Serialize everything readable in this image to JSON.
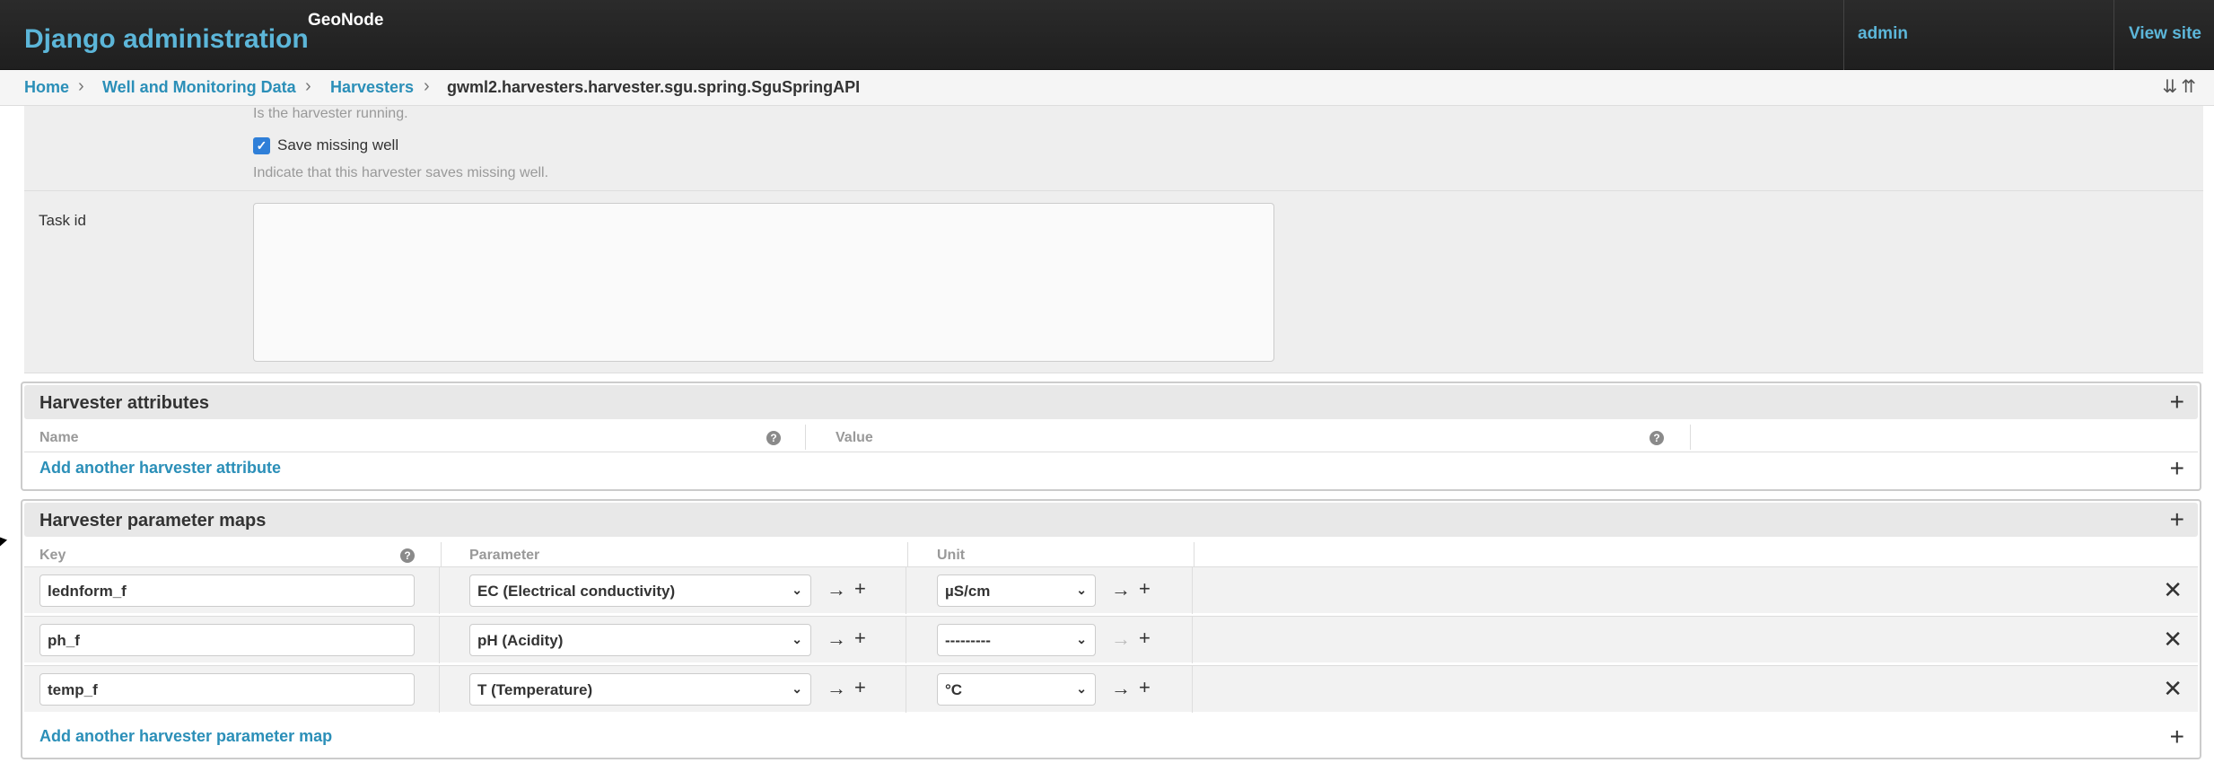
{
  "header": {
    "brand": "Django administration",
    "sub_brand": "GeoNode",
    "user": "admin",
    "view_site": "View site"
  },
  "breadcrumbs": [
    {
      "label": "Home"
    },
    {
      "label": "Well and Monitoring Data"
    },
    {
      "label": "Harvesters"
    },
    {
      "label": "gwml2.harvesters.harvester.sgu.spring.SguSpringAPI"
    }
  ],
  "form": {
    "running_help": "Is the harvester running.",
    "save_missing_well_label": "Save missing well",
    "save_missing_well_checked": true,
    "save_missing_well_help": "Indicate that this harvester saves missing well.",
    "task_id_label": "Task id",
    "task_id_value": ""
  },
  "attributes": {
    "title": "Harvester attributes",
    "col_name": "Name",
    "col_value": "Value",
    "add_label": "Add another harvester attribute"
  },
  "parameter_maps": {
    "title": "Harvester parameter maps",
    "col_key": "Key",
    "col_parameter": "Parameter",
    "col_unit": "Unit",
    "rows": [
      {
        "key": "lednform_f",
        "parameter": "EC (Electrical conductivity)",
        "unit": "µS/cm"
      },
      {
        "key": "ph_f",
        "parameter": "pH (Acidity)",
        "unit": "---------"
      },
      {
        "key": "temp_f",
        "parameter": "T (Temperature)",
        "unit": "°C"
      }
    ],
    "add_label": "Add another harvester parameter map"
  },
  "icons": {
    "checkmark": "✓",
    "chevron": "⌄",
    "help": "?",
    "arrow": "→",
    "plus": "+",
    "delete": "✕",
    "collapse": "⇊⇈"
  },
  "colors": {
    "header_bg": "#262626",
    "link": "#2b8fb8",
    "brand": "#5cb6d9",
    "checkbox": "#2f7fd8"
  }
}
